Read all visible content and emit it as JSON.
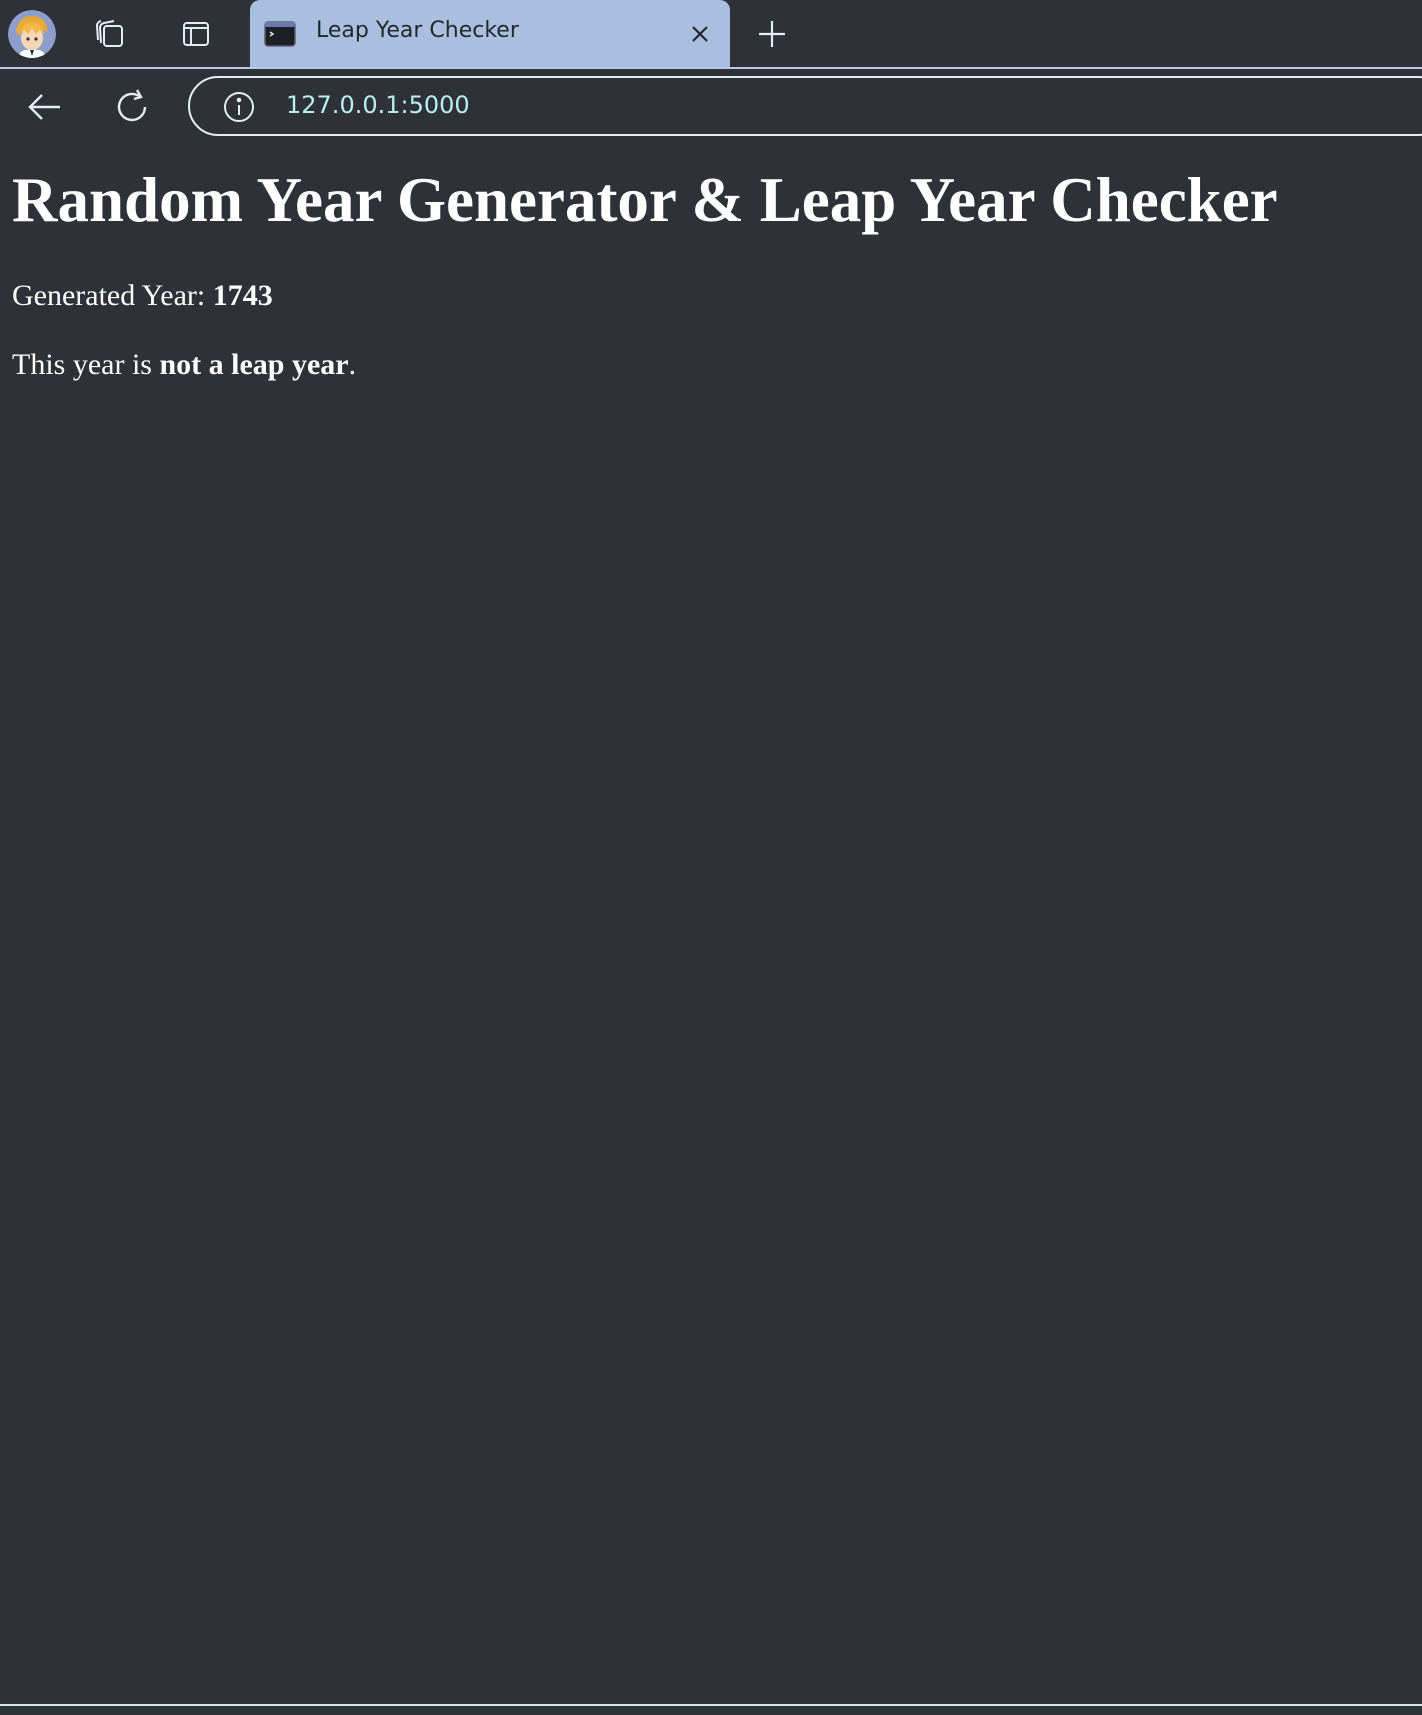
{
  "tab": {
    "title": "Leap Year Checker"
  },
  "address_bar": {
    "url": "127.0.0.1:5000"
  },
  "page": {
    "heading": "Random Year Generator & Leap Year Checker",
    "generated_year_label": "Generated Year:",
    "generated_year_value": "1743",
    "result_prefix": "This year is",
    "result_value": "not a leap year",
    "result_suffix": "."
  },
  "icons": {
    "avatar": "user-avatar",
    "workspaces": "workspaces-icon",
    "tab_actions": "tab-actions-icon",
    "favicon": "terminal-favicon-icon",
    "close": "close-icon",
    "new_tab": "plus-icon",
    "back": "back-arrow-icon",
    "refresh": "refresh-icon",
    "site_info": "info-icon"
  },
  "colors": {
    "background": "#2e3138",
    "active_tab": "#aabfdf",
    "url_text": "#b9f0ee",
    "page_text": "#ffffff"
  }
}
